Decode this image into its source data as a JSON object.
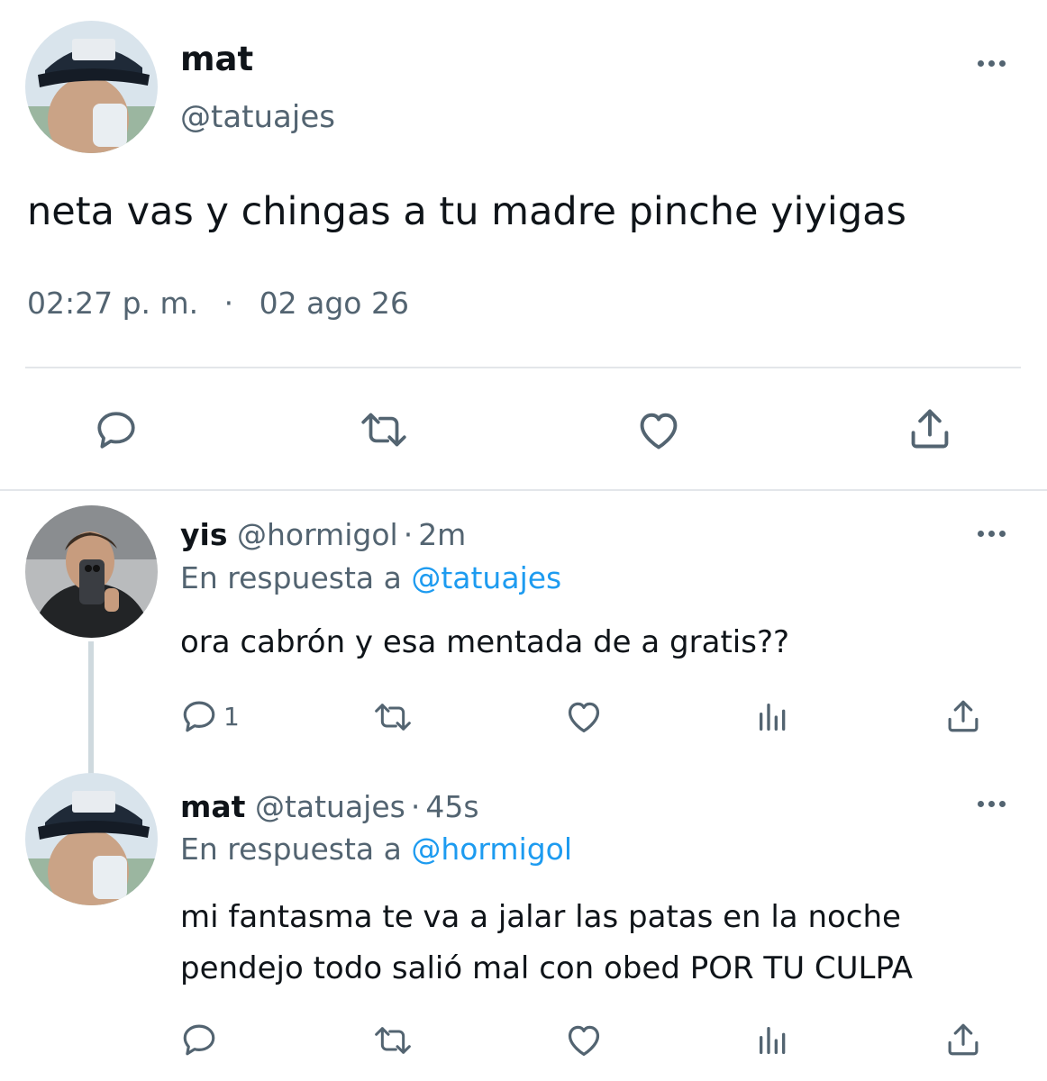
{
  "main_tweet": {
    "author_name": "mat",
    "handle": "@tatuajes",
    "text": "neta vas y chingas a tu madre pinche yiyigas",
    "time": "02:27 p. m.",
    "separator": "·",
    "date": "02 ago 26"
  },
  "replies": [
    {
      "author_name": "yis",
      "handle": "@hormigol",
      "dot": "·",
      "age": "2m",
      "reply_prefix": "En respuesta a",
      "reply_to": "@tatuajes",
      "text": "ora cabrón y esa mentada de a gratis??",
      "reply_count": "1"
    },
    {
      "author_name": "mat",
      "handle": "@tatuajes",
      "dot": "·",
      "age": "45s",
      "reply_prefix": "En respuesta a",
      "reply_to": "@hormigol",
      "text_line1": "mi fantasma te va a jalar las patas en la noche",
      "text_line2": "pendejo todo salió mal con obed POR TU CULPA"
    }
  ],
  "icons": {
    "reply": "comment-icon",
    "retweet": "retweet-icon",
    "like": "heart-icon",
    "views": "views-icon",
    "share": "share-icon",
    "more": "more-icon"
  },
  "colors": {
    "text": "#0f1419",
    "secondary": "#536471",
    "link": "#1d9bf0",
    "divider": "#e3e6ea"
  }
}
